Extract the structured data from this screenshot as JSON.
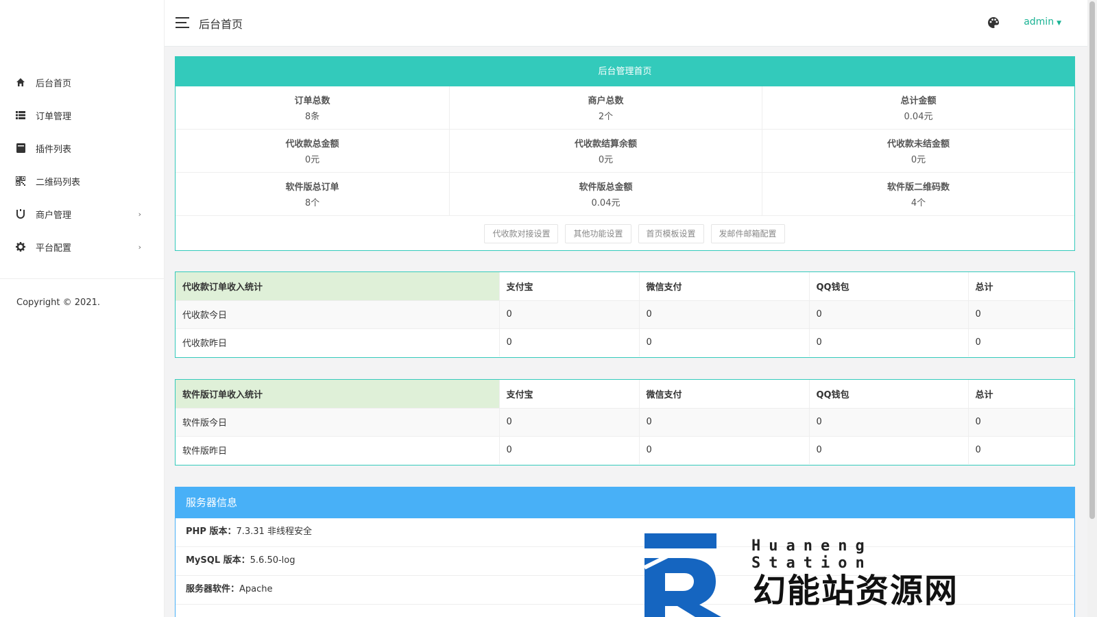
{
  "sidebar": {
    "items": [
      {
        "label": "后台首页",
        "icon": "home-icon",
        "has_arrow": false
      },
      {
        "label": "订单管理",
        "icon": "list-icon",
        "has_arrow": false
      },
      {
        "label": "插件列表",
        "icon": "plugin-icon",
        "has_arrow": false
      },
      {
        "label": "二维码列表",
        "icon": "qrcode-icon",
        "has_arrow": false
      },
      {
        "label": "商户管理",
        "icon": "merchant-icon",
        "has_arrow": true
      },
      {
        "label": "平台配置",
        "icon": "gear-icon",
        "has_arrow": true
      }
    ],
    "arrow": "›",
    "copyright": "Copyright © 2021."
  },
  "topbar": {
    "title": "后台首页",
    "user": "admin",
    "caret": "▼"
  },
  "dashboard": {
    "title": "后台管理首页",
    "stats": [
      {
        "label": "订单总数",
        "value": "8条"
      },
      {
        "label": "商户总数",
        "value": "2个"
      },
      {
        "label": "总计金额",
        "value": "0.04元"
      },
      {
        "label": "代收款总金额",
        "value": "0元"
      },
      {
        "label": "代收款结算余额",
        "value": "0元"
      },
      {
        "label": "代收款未结金额",
        "value": "0元"
      },
      {
        "label": "软件版总订单",
        "value": "8个"
      },
      {
        "label": "软件版总金额",
        "value": "0.04元"
      },
      {
        "label": "软件版二维码数",
        "value": "4个"
      }
    ],
    "buttons": [
      "代收款对接设置",
      "其他功能设置",
      "首页模板设置",
      "发邮件邮箱配置"
    ]
  },
  "table1": {
    "headers": [
      "代收款订单收入统计",
      "支付宝",
      "微信支付",
      "QQ钱包",
      "总计"
    ],
    "rows": [
      [
        "代收款今日",
        "0",
        "0",
        "0",
        "0"
      ],
      [
        "代收款昨日",
        "0",
        "0",
        "0",
        "0"
      ]
    ]
  },
  "table2": {
    "headers": [
      "软件版订单收入统计",
      "支付宝",
      "微信支付",
      "QQ钱包",
      "总计"
    ],
    "rows": [
      [
        "软件版今日",
        "0",
        "0",
        "0",
        "0"
      ],
      [
        "软件版昨日",
        "0",
        "0",
        "0",
        "0"
      ]
    ]
  },
  "server": {
    "title": "服务器信息",
    "rows": [
      {
        "key": "PHP 版本：",
        "value": "7.3.31 非线程安全"
      },
      {
        "key": "MySQL 版本：",
        "value": "5.6.50-log"
      },
      {
        "key": "服务器软件：",
        "value": "Apache"
      }
    ]
  },
  "logo": {
    "en": "Huaneng Station",
    "cn": "幻能站资源网"
  },
  "colors": {
    "accent": "#33cabb",
    "blue": "#48b0f7",
    "user": "#1ab394",
    "table_head": "#dff0d8"
  }
}
